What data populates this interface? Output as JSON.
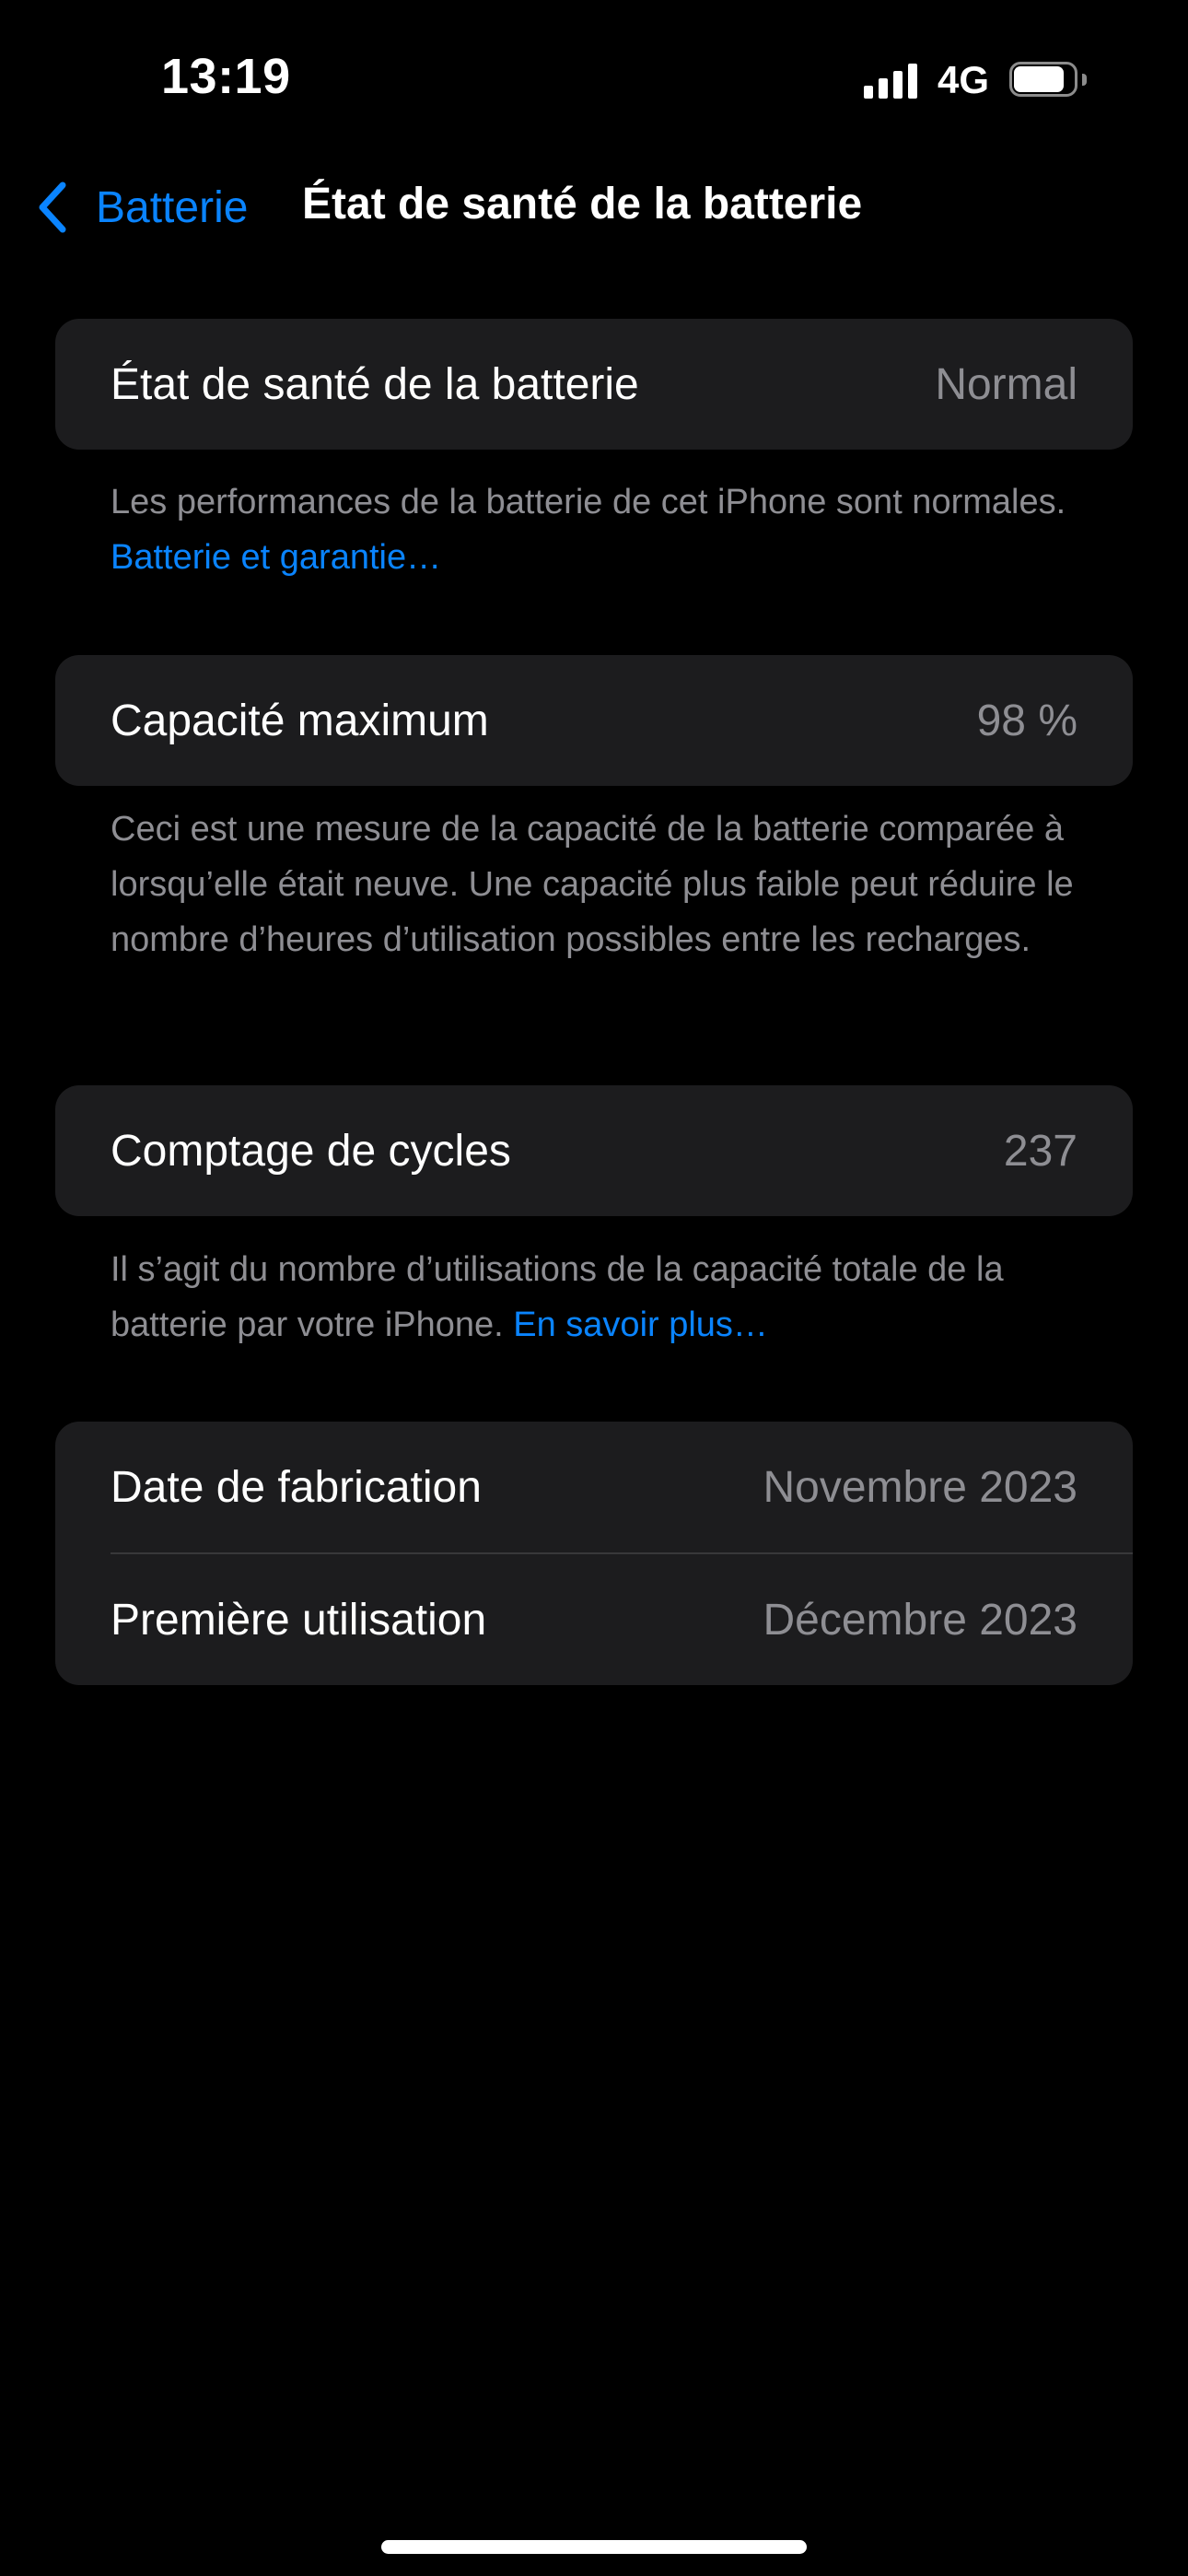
{
  "status_bar": {
    "time": "13:19",
    "network": "4G",
    "battery_level": 0.85
  },
  "nav": {
    "back_label": "Batterie",
    "title": "État de santé de la batterie"
  },
  "health": {
    "label": "État de santé de la batterie",
    "value": "Normal",
    "footnote": "Les performances de la batterie de cet iPhone sont normales.",
    "footnote_link": "Batterie et garantie…"
  },
  "capacity": {
    "label": "Capacité maximum",
    "value": "98 %",
    "footnote": "Ceci est une mesure de la capacité de la batterie comparée à lorsqu’elle était neuve. Une capacité plus faible peut réduire le nombre d’heures d’utilisation possibles entre les recharges."
  },
  "cycles": {
    "label": "Comptage de cycles",
    "value": "237",
    "footnote": "Il s’agit du nombre d’utilisations de la capacité totale de la batterie par votre iPhone.",
    "footnote_link": "En savoir plus…"
  },
  "dates": {
    "manufacture_label": "Date de fabrication",
    "manufacture_value": "Novembre 2023",
    "first_use_label": "Première utilisation",
    "first_use_value": "Décembre 2023"
  },
  "colors": {
    "accent": "#0a84ff",
    "background": "#000000",
    "cell": "#1c1c1e",
    "secondary_text": "#8e8e93"
  }
}
